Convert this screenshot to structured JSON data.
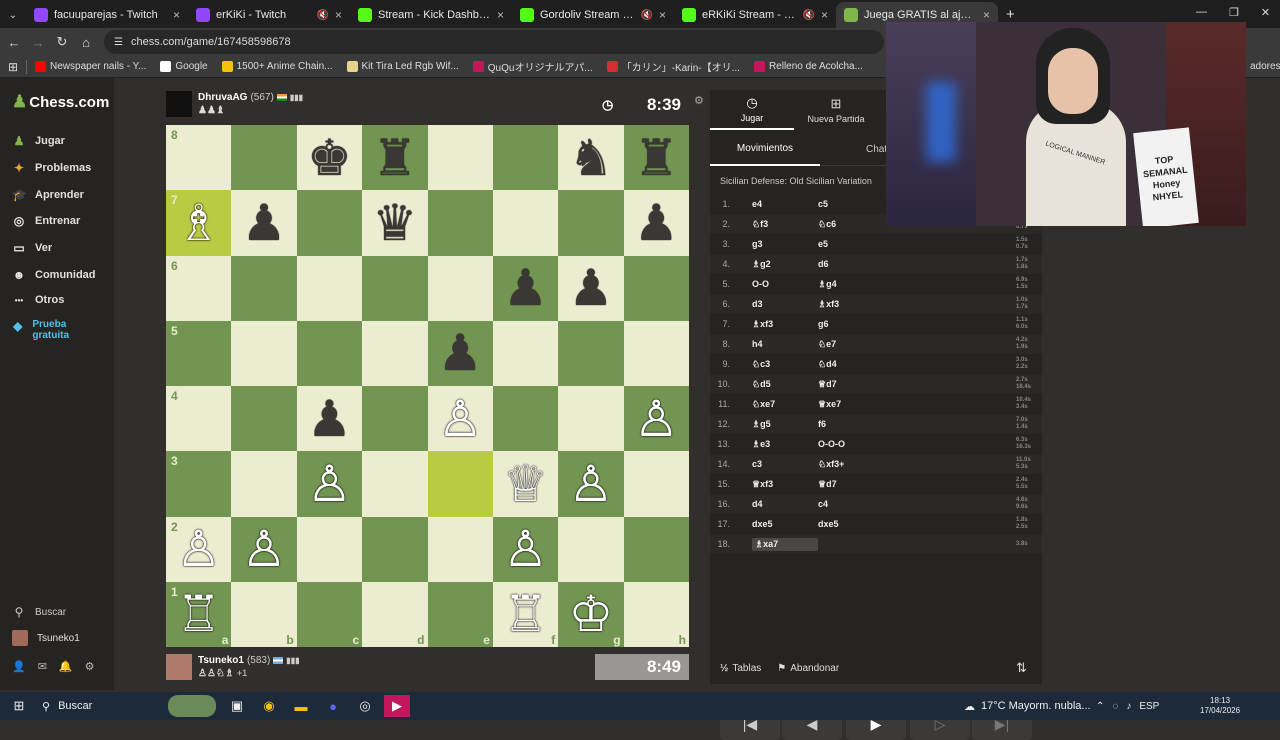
{
  "browser": {
    "tabs": [
      {
        "title": "facuuparejas - Twitch",
        "color": "#9146ff",
        "muted": false
      },
      {
        "title": "erKiKi - Twitch",
        "color": "#9146ff",
        "muted": true
      },
      {
        "title": "Stream - Kick Dashboard",
        "color": "#53fc18",
        "muted": false
      },
      {
        "title": "Gordoliv Stream - Watch Li",
        "color": "#53fc18",
        "muted": true
      },
      {
        "title": "eRKiKi Stream - Watch Live",
        "color": "#53fc18",
        "muted": true
      },
      {
        "title": "Juega GRATIS al ajedrez on",
        "color": "#81b64c",
        "muted": false,
        "active": true
      }
    ],
    "url": "chess.com/game/167458598678",
    "bookmarks": [
      {
        "label": "Newspaper nails - Y...",
        "color": "#ff0000"
      },
      {
        "label": "Google",
        "color": "#ffffff"
      },
      {
        "label": "1500+ Anime Chain...",
        "color": "#f4c20d"
      },
      {
        "label": "Kit Tira Led Rgb Wif...",
        "color": "#e5d48a"
      },
      {
        "label": "QuQuオリジナルアパ...",
        "color": "#c2185b"
      },
      {
        "label": "「カリン」-Karin-【オリ...",
        "color": "#d32f2f"
      },
      {
        "label": "Relleno de Acolcha...",
        "color": "#c2185b"
      },
      {
        "label": "Canasto Cesto Simil...",
        "color": "#e5d48a"
      },
      {
        "label": "Canasto Organiza",
        "color": "#e5d48a"
      }
    ],
    "bookmarks_more": "adores"
  },
  "nav": {
    "logo": "Chess.com",
    "items": [
      {
        "label": "Jugar",
        "icon": "pawn-icon",
        "color": "#81b64c"
      },
      {
        "label": "Problemas",
        "icon": "puzzle-icon",
        "color": "#f1a33b"
      },
      {
        "label": "Aprender",
        "icon": "graduation-icon",
        "color": "#3ba4d8"
      },
      {
        "label": "Entrenar",
        "icon": "target-icon",
        "color": "#e9e9e9"
      },
      {
        "label": "Ver",
        "icon": "tv-icon",
        "color": "#e9e9e9"
      },
      {
        "label": "Comunidad",
        "icon": "community-icon",
        "color": "#e9e9e9"
      },
      {
        "label": "Otros",
        "icon": "more-icon",
        "color": "#e9e9e9"
      },
      {
        "label": "Prueba gratuita",
        "icon": "diamond-icon",
        "color": "#54c0e8"
      }
    ],
    "search": "Buscar",
    "user": "Tsuneko1"
  },
  "opponent": {
    "name": "DhruvaAG",
    "rating": "(567)",
    "clock": "8:39"
  },
  "player": {
    "name": "Tsuneko1",
    "rating": "(583)",
    "clock": "8:49",
    "extra": "+1"
  },
  "board": {
    "ranks": [
      "8",
      "7",
      "6",
      "5",
      "4",
      "3",
      "2",
      "1"
    ],
    "files": [
      "a",
      "b",
      "c",
      "d",
      "e",
      "f",
      "g",
      "h"
    ],
    "highlight": [
      "e3"
    ],
    "pieces": [
      {
        "sq": "c8",
        "p": "bk"
      },
      {
        "sq": "d8",
        "p": "br"
      },
      {
        "sq": "g8",
        "p": "bn"
      },
      {
        "sq": "h8",
        "p": "br"
      },
      {
        "sq": "a7",
        "p": "wb"
      },
      {
        "sq": "b7",
        "p": "bp"
      },
      {
        "sq": "d7",
        "p": "bq"
      },
      {
        "sq": "h7",
        "p": "bp"
      },
      {
        "sq": "f6",
        "p": "bp"
      },
      {
        "sq": "g6",
        "p": "bp"
      },
      {
        "sq": "e5",
        "p": "bp"
      },
      {
        "sq": "c4",
        "p": "bp"
      },
      {
        "sq": "e4",
        "p": "wp"
      },
      {
        "sq": "h4",
        "p": "wp"
      },
      {
        "sq": "c3",
        "p": "wp"
      },
      {
        "sq": "f3",
        "p": "wq"
      },
      {
        "sq": "g3",
        "p": "wp"
      },
      {
        "sq": "a2",
        "p": "wp"
      },
      {
        "sq": "b2",
        "p": "wp"
      },
      {
        "sq": "f2",
        "p": "wp"
      },
      {
        "sq": "a1",
        "p": "wr"
      },
      {
        "sq": "f1",
        "p": "wr"
      },
      {
        "sq": "g1",
        "p": "wk"
      }
    ]
  },
  "panel": {
    "tabs": [
      {
        "label": "Jugar",
        "icon": "stopwatch-icon"
      },
      {
        "label": "Nueva Partida",
        "icon": "plus-icon"
      }
    ],
    "subtabs": [
      "Movimientos",
      "Chat"
    ],
    "opening": "Sicilian Defense: Old Sicilian Variation",
    "moves": [
      [
        "1.",
        "e4",
        "c5"
      ],
      [
        "2.",
        "♘f3",
        "♘c6"
      ],
      [
        "3.",
        "g3",
        "e5"
      ],
      [
        "4.",
        "♗g2",
        "d6"
      ],
      [
        "5.",
        "O-O",
        "♗g4"
      ],
      [
        "6.",
        "d3",
        "♗xf3"
      ],
      [
        "7.",
        "♗xf3",
        "g6"
      ],
      [
        "8.",
        "h4",
        "♘e7"
      ],
      [
        "9.",
        "♘c3",
        "♘d4"
      ],
      [
        "10.",
        "♘d5",
        "♕d7"
      ],
      [
        "11.",
        "♘xe7",
        "♕xe7"
      ],
      [
        "12.",
        "♗g5",
        "f6"
      ],
      [
        "13.",
        "♗e3",
        "O-O-O"
      ],
      [
        "14.",
        "c3",
        "♘xf3+"
      ],
      [
        "15.",
        "♕xf3",
        "♕d7"
      ],
      [
        "16.",
        "d4",
        "c4"
      ],
      [
        "17.",
        "dxe5",
        "dxe5"
      ],
      [
        "18.",
        "♗xa7",
        ""
      ]
    ],
    "times": [
      [
        "",
        ""
      ],
      [
        "0.7s",
        "0.7s"
      ],
      [
        "1.5s",
        "0.7s"
      ],
      [
        "1.7s",
        "1.8s"
      ],
      [
        "6.9s",
        "1.5s"
      ],
      [
        "1.0s",
        "1.7s"
      ],
      [
        "1.1s",
        "6.0s"
      ],
      [
        "4.2s",
        "1.9s"
      ],
      [
        "3.0s",
        "2.2s"
      ],
      [
        "2.7s",
        "18.4s"
      ],
      [
        "10.4s",
        "3.4s"
      ],
      [
        "7.0s",
        "1.4s"
      ],
      [
        "6.3s",
        "16.3s"
      ],
      [
        "11.0s",
        "5.3s"
      ],
      [
        "2.4s",
        "5.5s"
      ],
      [
        "4.6s",
        "9.6s"
      ],
      [
        "1.8s",
        "2.5s"
      ],
      [
        "3.8s",
        ""
      ]
    ],
    "footer": {
      "tables": "Tablas",
      "resign": "Abandonar"
    }
  },
  "webcam": {
    "sign_lines": [
      "TOP",
      "SEMANAL",
      "Honey",
      "NHYEL"
    ],
    "shirt_text": "LOGICAL MANNER"
  },
  "taskbar": {
    "search": "Buscar",
    "weather": "17°C  Mayorm. nubla...",
    "lang": "ESP",
    "time": "18:13",
    "date": "17/04/2026"
  }
}
